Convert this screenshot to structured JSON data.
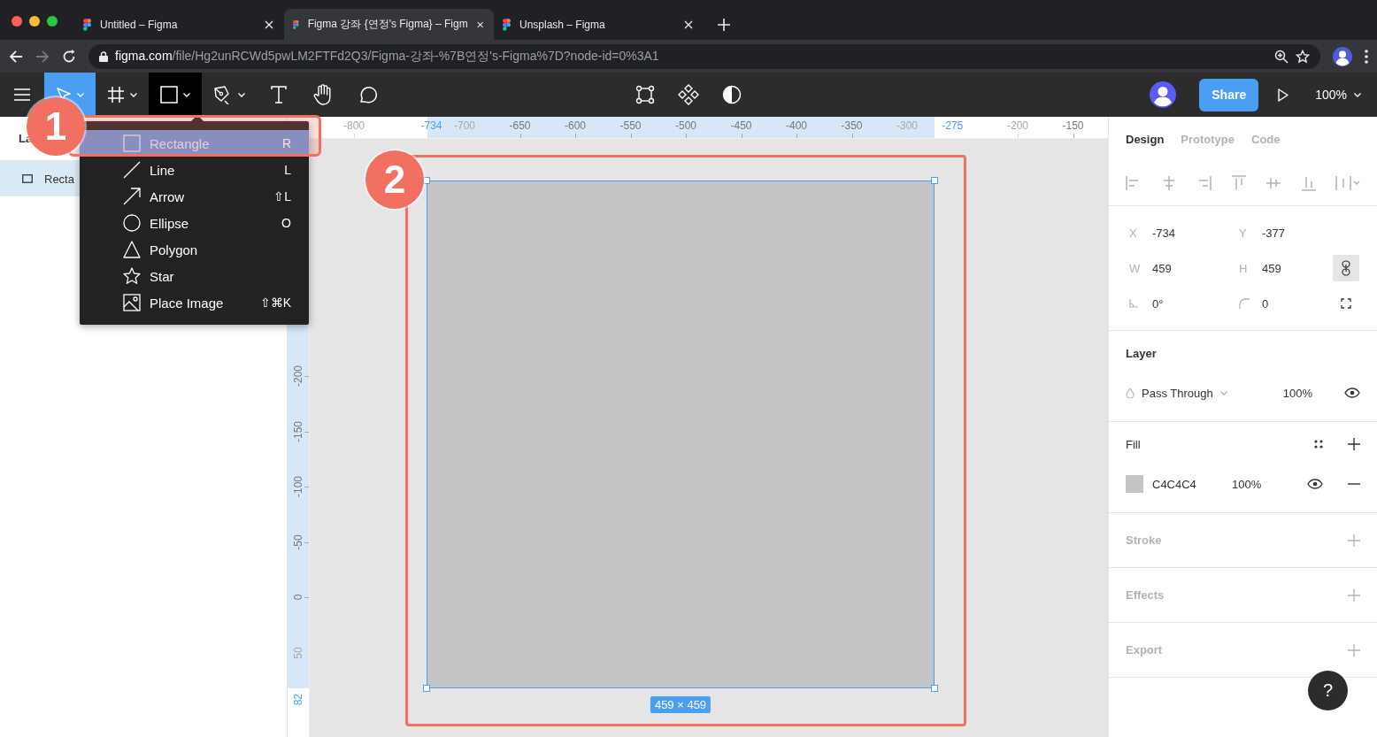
{
  "browser": {
    "tabs": [
      {
        "title": "Untitled – Figma",
        "selected": false
      },
      {
        "title": "Figma 강좌 {연정's Figma} – Figm",
        "selected": true
      },
      {
        "title": "Unsplash – Figma",
        "selected": false
      }
    ],
    "url": {
      "host": "figma.com",
      "path": "/file/Hg2unRCWd5pwLM2FTFd2Q3/Figma-강좌-%7B연정's-Figma%7D?node-id=0%3A1"
    }
  },
  "toolbar": {
    "tools": [
      {
        "kind": "menu",
        "selected": false,
        "open": false,
        "dropdown": false
      },
      {
        "kind": "move",
        "selected": true,
        "open": false,
        "dropdown": true
      },
      {
        "kind": "frame",
        "selected": false,
        "open": false,
        "dropdown": true
      },
      {
        "kind": "shape",
        "selected": false,
        "open": true,
        "dropdown": true
      },
      {
        "kind": "pen",
        "selected": false,
        "open": false,
        "dropdown": true
      },
      {
        "kind": "text",
        "selected": false,
        "open": false,
        "dropdown": false
      },
      {
        "kind": "hand",
        "selected": false,
        "open": false,
        "dropdown": false
      },
      {
        "kind": "comment",
        "selected": false,
        "open": false,
        "dropdown": false
      }
    ],
    "center_tools": [
      {
        "kind": "component"
      },
      {
        "kind": "components"
      },
      {
        "kind": "mask"
      }
    ],
    "share": "Share",
    "zoom": "100%"
  },
  "layers_panel": {
    "title": "La",
    "layers": [
      {
        "name": "Recta",
        "selected": true
      }
    ]
  },
  "shape_menu": {
    "items": [
      {
        "kind": "rectangle",
        "label": "Rectangle",
        "shortcut": "R",
        "selected": true
      },
      {
        "kind": "line",
        "label": "Line",
        "shortcut": "L",
        "selected": false
      },
      {
        "kind": "arrow",
        "label": "Arrow",
        "shortcut": "⇧L",
        "selected": false
      },
      {
        "kind": "ellipse",
        "label": "Ellipse",
        "shortcut": "O",
        "selected": false
      },
      {
        "kind": "polygon",
        "label": "Polygon",
        "selected": false
      },
      {
        "kind": "star",
        "label": "Star",
        "selected": false
      },
      {
        "kind": "image",
        "label": "Place Image",
        "shortcut": "⇧⌘K",
        "selected": false
      }
    ]
  },
  "rulers": {
    "horizontal": [
      {
        "label": "-800",
        "kind": "faded"
      },
      {
        "label": "-734",
        "kind": "selection_start"
      },
      {
        "label": "-700",
        "kind": "faded"
      },
      {
        "label": "-650",
        "kind": "normal"
      },
      {
        "label": "-600",
        "kind": "normal"
      },
      {
        "label": "-550",
        "kind": "normal"
      },
      {
        "label": "-500",
        "kind": "normal"
      },
      {
        "label": "-450",
        "kind": "normal"
      },
      {
        "label": "-400",
        "kind": "normal"
      },
      {
        "label": "-350",
        "kind": "normal"
      },
      {
        "label": "-300",
        "kind": "faded"
      },
      {
        "label": "-275",
        "kind": "selection_end"
      },
      {
        "label": "-200",
        "kind": "faded"
      },
      {
        "label": "-150",
        "kind": "normal"
      }
    ],
    "vertical": [
      {
        "label": "-200",
        "kind": "normal"
      },
      {
        "label": "-150",
        "kind": "normal"
      },
      {
        "label": "-100",
        "kind": "normal"
      },
      {
        "label": "-50",
        "kind": "normal"
      },
      {
        "label": "0",
        "kind": "normal"
      },
      {
        "label": "50",
        "kind": "faded"
      },
      {
        "label": "82",
        "kind": "selection_end"
      }
    ]
  },
  "canvas": {
    "size_label": "459 × 459",
    "selected": true
  },
  "annotations": [
    {
      "label": "1"
    },
    {
      "label": "2"
    }
  ],
  "design_panel": {
    "tabs": [
      {
        "label": "Design",
        "selected": true
      },
      {
        "label": "Prototype",
        "selected": false
      },
      {
        "label": "Code",
        "selected": false
      }
    ],
    "fields": [
      {
        "kind": "letter",
        "label": "X",
        "value": "-734"
      },
      {
        "kind": "letter",
        "label": "Y",
        "value": "-377"
      },
      {
        "kind": "letter",
        "label": "W",
        "value": "459"
      },
      {
        "kind": "letter",
        "label": "H",
        "value": "459"
      },
      {
        "kind": "rotation",
        "value": "0°"
      },
      {
        "kind": "radius",
        "value": "0"
      }
    ],
    "constrain_proportions": true,
    "layer": {
      "title": "Layer",
      "blend_mode": "Pass Through",
      "opacity": "100%",
      "visible": true
    },
    "fill": {
      "title": "Fill",
      "fills": [
        {
          "color": "#c4c4c4",
          "hex": "C4C4C4",
          "opacity": "100%",
          "visible": true
        }
      ]
    },
    "empty_sections": [
      {
        "title": "Stroke"
      },
      {
        "title": "Effects"
      },
      {
        "title": "Export"
      }
    ],
    "help": "?"
  }
}
